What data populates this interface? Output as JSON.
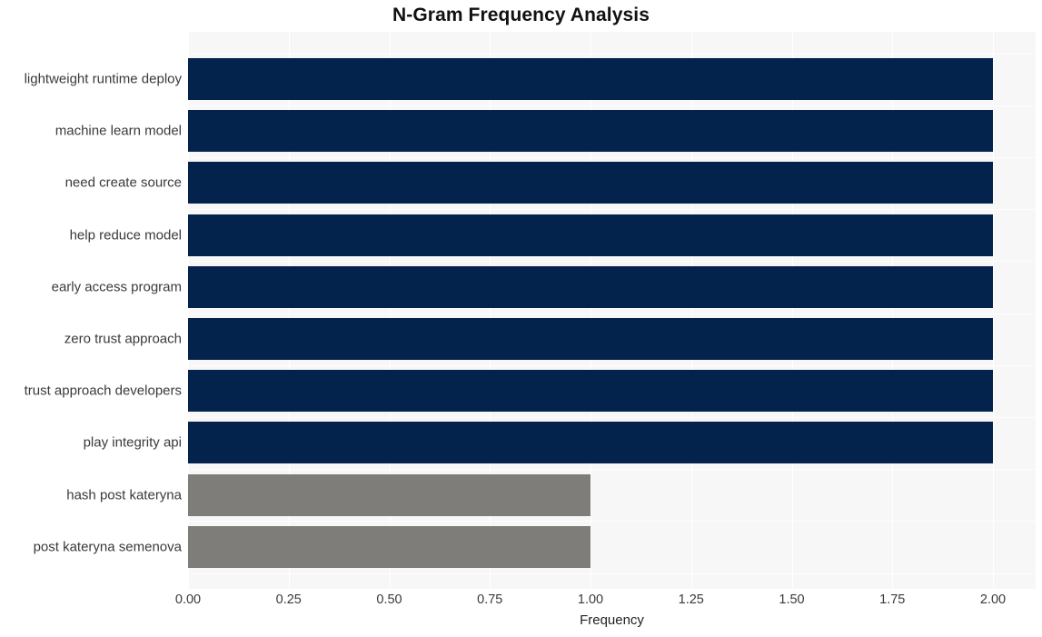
{
  "chart_data": {
    "type": "bar",
    "orientation": "horizontal",
    "title": "N-Gram Frequency Analysis",
    "xlabel": "Frequency",
    "ylabel": "",
    "xlim": [
      0,
      2.0
    ],
    "grid": true,
    "legend": null,
    "categories": [
      "lightweight runtime deploy",
      "machine learn model",
      "need create source",
      "help reduce model",
      "early access program",
      "zero trust approach",
      "trust approach developers",
      "play integrity api",
      "hash post kateryna",
      "post kateryna semenova"
    ],
    "values": [
      2,
      2,
      2,
      2,
      2,
      2,
      2,
      2,
      1,
      1
    ],
    "bar_colors": [
      "#04234c",
      "#04234c",
      "#04234c",
      "#04234c",
      "#04234c",
      "#04234c",
      "#04234c",
      "#04234c",
      "#7f7d7a",
      "#7f7d7a"
    ],
    "xticks": [
      "0.00",
      "0.25",
      "0.50",
      "0.75",
      "1.00",
      "1.25",
      "1.50",
      "1.75",
      "2.00"
    ],
    "xtick_values": [
      0,
      0.25,
      0.5,
      0.75,
      1.0,
      1.25,
      1.5,
      1.75,
      2.0
    ],
    "plot_background": "#f7f7f7",
    "figure_background": "#ffffff",
    "gridline_color": "#ffffff"
  }
}
